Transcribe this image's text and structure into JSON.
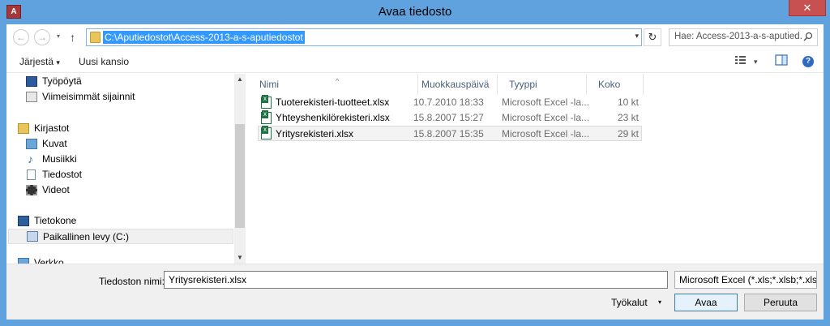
{
  "window": {
    "title": "Avaa tiedosto",
    "app_icon_label": "A",
    "close_symbol": "✕"
  },
  "address": {
    "back_symbol": "←",
    "forward_symbol": "→",
    "recent_symbol": "▾",
    "up_symbol": "↑",
    "path": "C:\\Aputiedostot\\Access-2013-a-s-aputiedostot",
    "dropdown_symbol": "▾",
    "refresh_symbol": "↻",
    "search_placeholder": "Hae: Access-2013-a-s-aputied...",
    "search_icon": "search-icon"
  },
  "toolbar": {
    "organize_label": "Järjestä",
    "organize_arrow": "▾",
    "new_folder_label": "Uusi kansio",
    "view_arrow": "▾",
    "help_symbol": "?"
  },
  "nav": {
    "items": [
      {
        "label": "Työpöytä",
        "icon": "desktop-icon"
      },
      {
        "label": "Viimeisimmät sijainnit",
        "icon": "recent-places-icon"
      },
      {
        "label": "Kirjastot",
        "icon": "libraries-icon"
      },
      {
        "label": "Kuvat",
        "icon": "pictures-icon"
      },
      {
        "label": "Musiikki",
        "icon": "music-icon"
      },
      {
        "label": "Tiedostot",
        "icon": "documents-icon"
      },
      {
        "label": "Videot",
        "icon": "videos-icon"
      },
      {
        "label": "Tietokone",
        "icon": "computer-icon"
      },
      {
        "label": "Paikallinen levy (C:)",
        "icon": "drive-icon"
      },
      {
        "label": "Verkko",
        "icon": "network-icon"
      }
    ]
  },
  "scroll": {
    "up": "▲",
    "down": "▼"
  },
  "files": {
    "sort_arrow": "^",
    "columns": [
      "Nimi",
      "Muokkauspäivä",
      "Tyyppi",
      "Koko"
    ],
    "rows": [
      {
        "name": "Tuoterekisteri-tuotteet.xlsx",
        "date": "10.7.2010 18:33",
        "type": "Microsoft Excel -la...",
        "size": "10 kt"
      },
      {
        "name": "Yhteyshenkilörekisteri.xlsx",
        "date": "15.8.2007 15:27",
        "type": "Microsoft Excel -la...",
        "size": "23 kt"
      },
      {
        "name": "Yritysrekisteri.xlsx",
        "date": "15.8.2007 15:35",
        "type": "Microsoft Excel -la...",
        "size": "29 kt"
      }
    ]
  },
  "bottom": {
    "filename_label": "Tiedoston nimi:",
    "filename_value": "Yritysrekisteri.xlsx",
    "filter_value": "Microsoft Excel (*.xls;*.xlsb;*.xls",
    "tools_label": "Työkalut",
    "tools_arrow": "▾",
    "open_label": "Avaa",
    "cancel_label": "Peruuta"
  }
}
